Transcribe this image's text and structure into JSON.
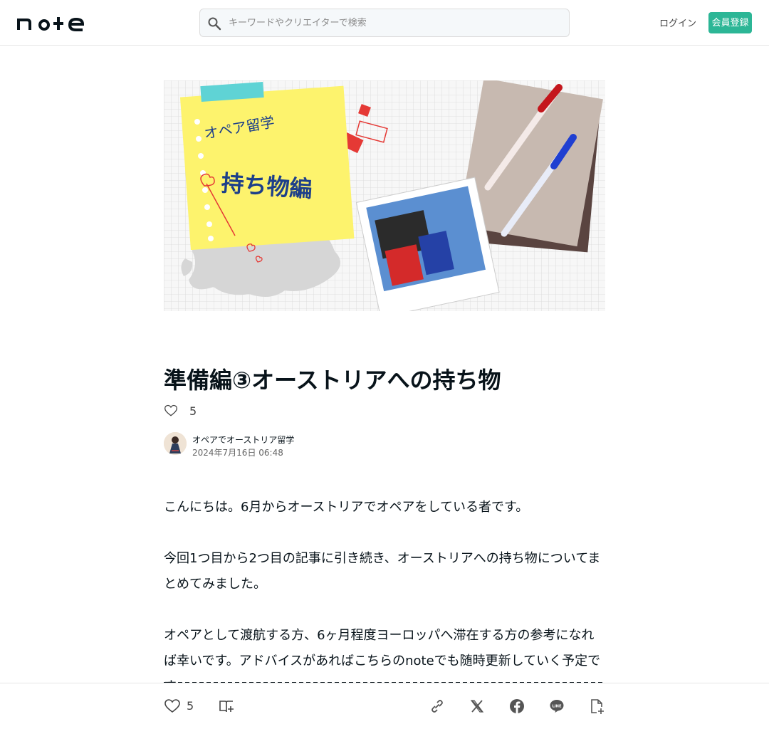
{
  "header": {
    "logo_text": "note",
    "search_placeholder": "キーワードやクリエイターで検索",
    "login_label": "ログイン",
    "signup_label": "会員登録"
  },
  "hero": {
    "line1": "オペア留学",
    "line2": "持ち物編"
  },
  "article": {
    "title": "準備編③オーストリアへの持ち物",
    "like_count": "5",
    "author_name": "オペアでオーストリア留学",
    "date": "2024年7月16日 06:48",
    "paragraphs": [
      "こんにちは。6月からオーストリアでオペアをしている者です。",
      "今回1つ目から2つ目の記事に引き続き、オーストリアへの持ち物についてまとめてみました。",
      "オペアとして渡航する方、6ヶ月程度ヨーロッパへ滞在する方の参考になれば幸いです。アドバイスがあればこちらのnoteでも随時更新していく予定です。"
    ]
  },
  "bottom_bar": {
    "like_count": "5"
  },
  "colors": {
    "accent": "#2cb696",
    "text": "#08131a"
  },
  "icons": [
    "search-icon",
    "heart-icon",
    "magazine-add-icon",
    "link-icon",
    "x-icon",
    "facebook-icon",
    "line-icon",
    "note-add-icon"
  ]
}
